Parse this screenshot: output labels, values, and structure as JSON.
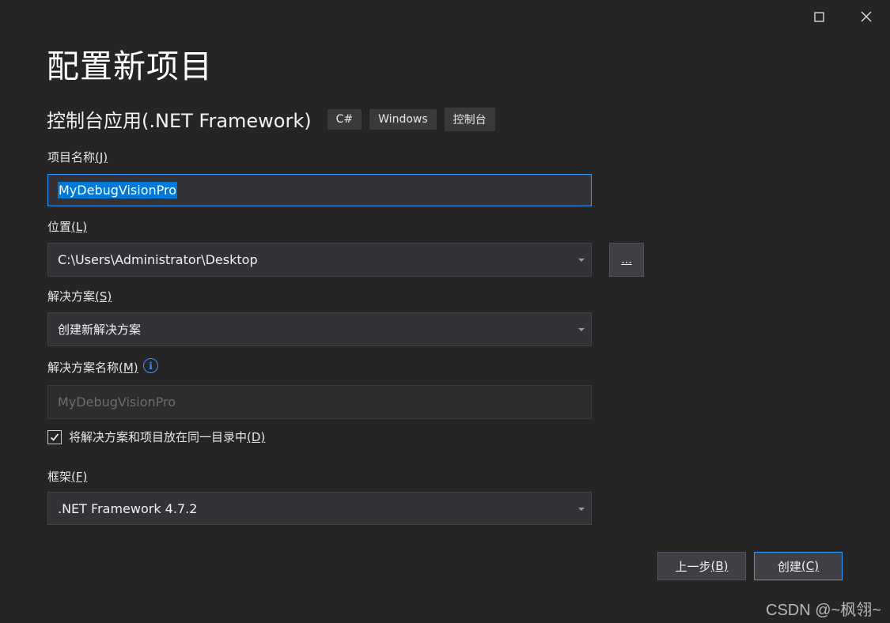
{
  "window": {
    "maximize_icon": "maximize-icon",
    "close_icon": "close-icon"
  },
  "title": "配置新项目",
  "template": {
    "name": "控制台应用(.NET Framework)",
    "tags": [
      "C#",
      "Windows",
      "控制台"
    ]
  },
  "project_name": {
    "label": "项目名称",
    "accesskey": "(J)",
    "value": "MyDebugVisionPro"
  },
  "location": {
    "label": "位置",
    "accesskey": "(L)",
    "value": "C:\\Users\\Administrator\\Desktop",
    "browse_label": "..."
  },
  "solution": {
    "label": "解决方案",
    "accesskey": "(S)",
    "value": "创建新解决方案"
  },
  "solution_name": {
    "label": "解决方案名称",
    "accesskey": "(M)",
    "value": "MyDebugVisionPro",
    "info_icon": "info-icon"
  },
  "same_dir": {
    "label": "将解决方案和项目放在同一目录中",
    "accesskey": "(D)",
    "checked": true
  },
  "framework": {
    "label": "框架",
    "accesskey": "(F)",
    "value": ".NET Framework 4.7.2"
  },
  "buttons": {
    "back": "上一步",
    "back_key": "(B)",
    "create": "创建",
    "create_key": "(C)"
  },
  "watermark": "CSDN @~枫翎~"
}
